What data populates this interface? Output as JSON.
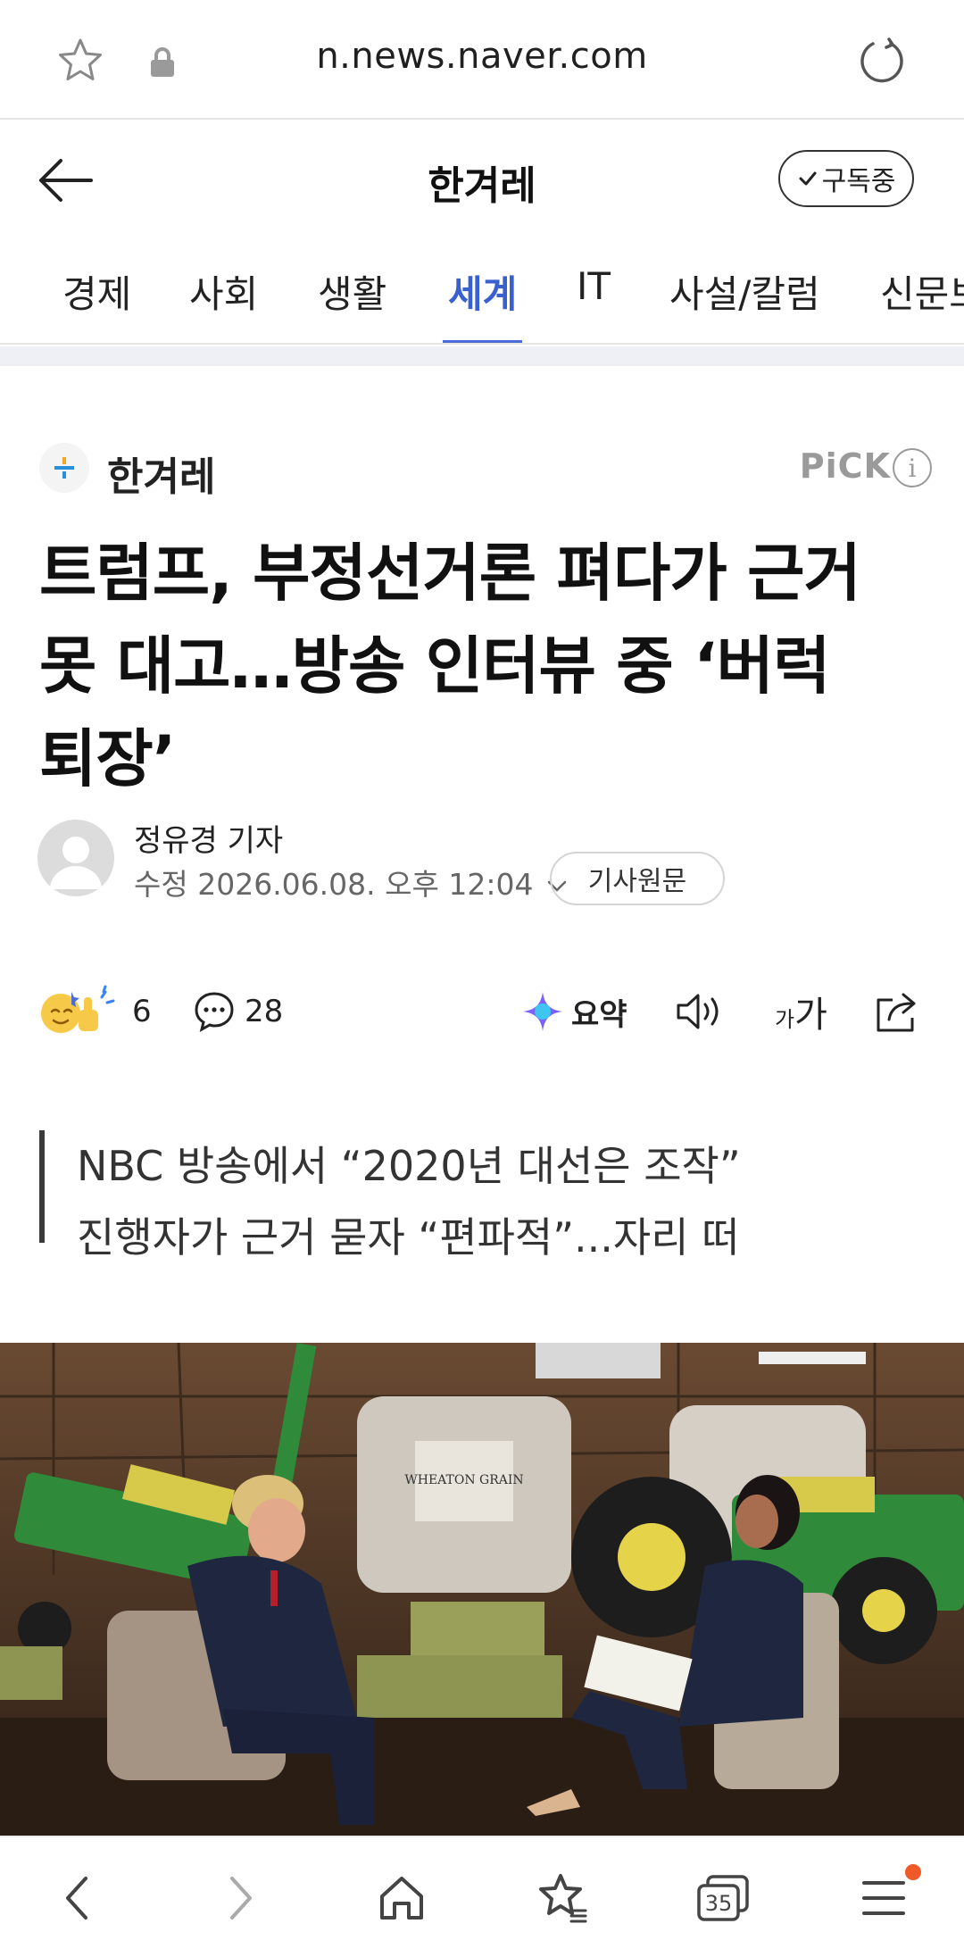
{
  "browser": {
    "url": "n.news.naver.com",
    "tab_count": "35"
  },
  "header": {
    "press_title": "한겨레",
    "subscribe_label": "구독중"
  },
  "categories": [
    {
      "label": "경제",
      "active": false
    },
    {
      "label": "사회",
      "active": false
    },
    {
      "label": "생활",
      "active": false
    },
    {
      "label": "세계",
      "active": true
    },
    {
      "label": "IT",
      "active": false
    },
    {
      "label": "사설/칼럼",
      "active": false
    },
    {
      "label": "신문보",
      "active": false
    }
  ],
  "article": {
    "press_name": "한겨레",
    "pick_label": "PiCK",
    "headline_lines": [
      "트럼프, 부정선거론 펴다가 근거",
      "못 대고…방송 인터뷰 중 ‘버럭",
      "퇴장’"
    ],
    "reporter": "정유경 기자",
    "date": "수정 2026.06.08. 오후 12:04",
    "original_label": "기사원문",
    "reaction_count": "6",
    "comment_count": "28",
    "summary_label": "요약",
    "font_size_label_small": "가",
    "font_size_label_large": "가",
    "subtitle_lines": [
      "NBC 방송에서 “2020년 대선은 조작”",
      "진행자가 근거 묻자 “편파적”...자리 떠"
    ],
    "photo_sign_text": "WHEATON GRAIN"
  },
  "colors": {
    "accent_blue": "#3a5fcf",
    "notification_dot": "#f05a28"
  }
}
